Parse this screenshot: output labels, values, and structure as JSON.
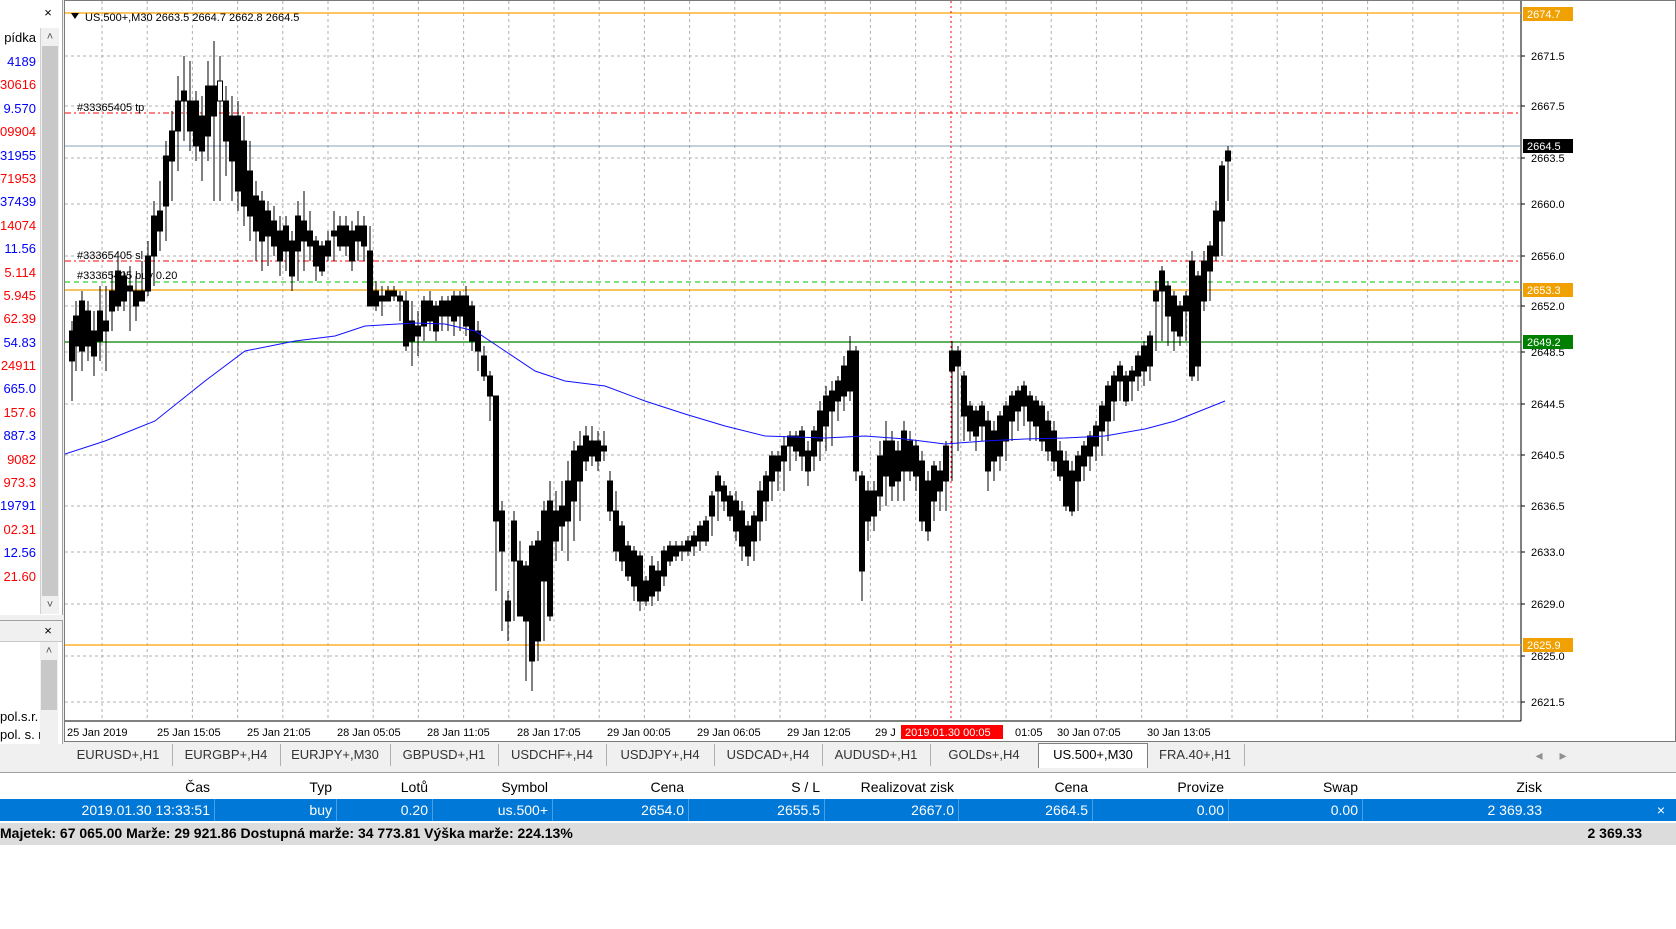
{
  "market_watch": {
    "header": "pídka",
    "close": "×",
    "prices": [
      {
        "text": "4189",
        "color": "#0000ff"
      },
      {
        "text": "30616",
        "color": "#ff0000"
      },
      {
        "text": "9.570",
        "color": "#0000ff"
      },
      {
        "text": "09904",
        "color": "#ff0000"
      },
      {
        "text": "31955",
        "color": "#0000ff"
      },
      {
        "text": "71953",
        "color": "#ff0000"
      },
      {
        "text": "37439",
        "color": "#0000ff"
      },
      {
        "text": "14074",
        "color": "#ff0000"
      },
      {
        "text": "11.56",
        "color": "#0000ff"
      },
      {
        "text": "5.114",
        "color": "#ff0000"
      },
      {
        "text": "5.945",
        "color": "#ff0000"
      },
      {
        "text": "62.39",
        "color": "#ff0000"
      },
      {
        "text": "54.83",
        "color": "#0000ff"
      },
      {
        "text": "24911",
        "color": "#ff0000"
      },
      {
        "text": "665.0",
        "color": "#0000ff"
      },
      {
        "text": "157.6",
        "color": "#ff0000"
      },
      {
        "text": "887.3",
        "color": "#0000ff"
      },
      {
        "text": "9082",
        "color": "#ff0000"
      },
      {
        "text": "973.3",
        "color": "#ff0000"
      },
      {
        "text": "19791",
        "color": "#0000ff"
      },
      {
        "text": "02.31",
        "color": "#ff0000"
      },
      {
        "text": "12.56",
        "color": "#0000ff"
      },
      {
        "text": "21.60",
        "color": "#ff0000"
      }
    ],
    "scroll_up": "˄",
    "scroll_down": "˅"
  },
  "navigator": {
    "close": "×",
    "items": [
      "pol.s.r.",
      "pol. s. r."
    ]
  },
  "chart": {
    "header": "US.500+,M30  2663.5 2664.7 2662.8 2664.5",
    "order_labels": {
      "tp": "#33365405 tp",
      "sl": "#33365405 sl",
      "buy": "#33365405 buy 0.20"
    },
    "price_ticks": [
      "2671.5",
      "2667.5",
      "2663.5",
      "2660.0",
      "2656.0",
      "2652.0",
      "2648.5",
      "2644.5",
      "2640.5",
      "2636.5",
      "2633.0",
      "2629.0",
      "2625.0",
      "2621.5"
    ],
    "price_labels": {
      "top": {
        "text": "2674.7",
        "color": "#f0a000"
      },
      "current": {
        "text": "2664.5",
        "color": "#000000"
      },
      "yellow": {
        "text": "2653.3",
        "color": "#f0a000"
      },
      "green": {
        "text": "2649.2",
        "color": "#008000"
      },
      "bottom": {
        "text": "2625.9",
        "color": "#f0a000"
      }
    },
    "time_labels": [
      "25 Jan 2019",
      "25 Jan 15:05",
      "25 Jan 21:05",
      "28 Jan 05:05",
      "28 Jan 11:05",
      "28 Jan 17:05",
      "29 Jan 00:05",
      "29 Jan 06:05",
      "29 Jan 12:05",
      "29 J",
      "01:05",
      "30 Jan 07:05",
      "30 Jan 13:05"
    ],
    "crosshair_label": "2019.01.30 00:05",
    "colors": {
      "ma": "#1010ff",
      "tp": "#ff0000",
      "sl": "#ff0000",
      "buy": "#00c000",
      "yellow": "#f0a000",
      "green": "#008000",
      "orange": "#ffa500"
    }
  },
  "tabs": [
    {
      "label": "EURUSD+,H1",
      "active": false
    },
    {
      "label": "EURGBP+,H4",
      "active": false
    },
    {
      "label": "EURJPY+,M30",
      "active": false
    },
    {
      "label": "GBPUSD+,H1",
      "active": false
    },
    {
      "label": "USDCHF+,H4",
      "active": false
    },
    {
      "label": "USDJPY+,H4",
      "active": false
    },
    {
      "label": "USDCAD+,H4",
      "active": false
    },
    {
      "label": "AUDUSD+,H1",
      "active": false
    },
    {
      "label": "GOLDs+,H4",
      "active": false
    },
    {
      "label": "US.500+,M30",
      "active": true
    },
    {
      "label": "FRA.40+,H1",
      "active": false
    }
  ],
  "tab_scroll": {
    "left": "◂",
    "right": "▸"
  },
  "terminal": {
    "columns": [
      "Čas",
      "Typ",
      "Lotů",
      "Symbol",
      "Cena",
      "S / L",
      "Realizovat zisk",
      "Cena",
      "Provize",
      "Swap",
      "Zisk"
    ],
    "row": [
      "2019.01.30 13:33:51",
      "buy",
      "0.20",
      "us.500+",
      "2654.0",
      "2655.5",
      "2667.0",
      "2664.5",
      "0.00",
      "0.00",
      "2 369.33"
    ],
    "summary": "Majetek: 67 065.00  Marže: 29 921.86  Dostupná marže: 34 773.81  Výška marže: 224.13%",
    "summary_total": "2 369.33",
    "close": "×"
  }
}
